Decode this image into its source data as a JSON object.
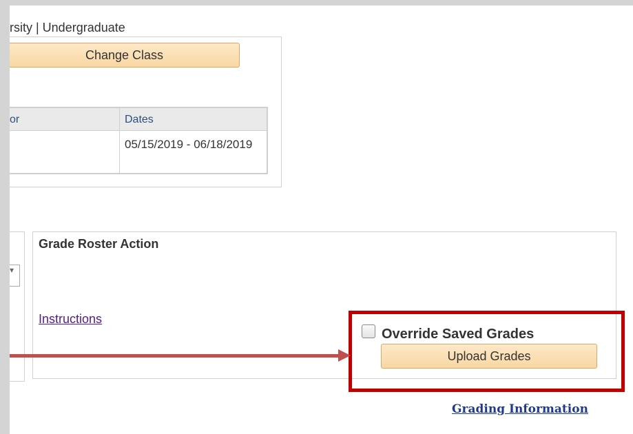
{
  "header": {
    "institution": "rsity | Undergraduate"
  },
  "class_section": {
    "change_class_label": "Change Class",
    "table": {
      "col1_header": "or",
      "col2_header": "Dates",
      "dates_value": "05/15/2019 - 06/18/2019"
    }
  },
  "grade_roster": {
    "title": "Grade Roster Action",
    "instructions_label": "Instructions",
    "override_label": "Override Saved Grades",
    "override_checked": false,
    "upload_label": "Upload Grades"
  },
  "footer": {
    "grading_info_label": "Grading Information"
  },
  "colors": {
    "highlight": "#c00000",
    "arrow": "#c0504d",
    "button": "#f9d7a3"
  },
  "icons": {
    "select_chevron": "chevron-down-icon"
  }
}
